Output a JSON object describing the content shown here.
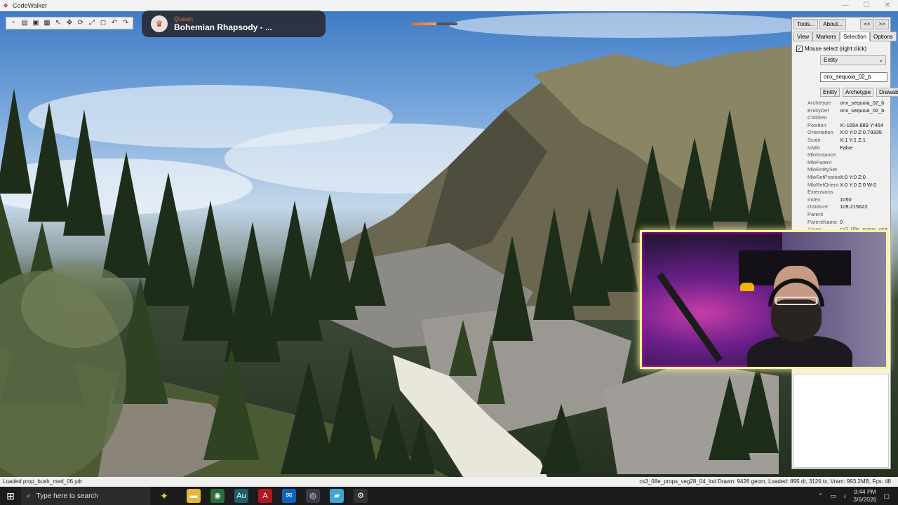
{
  "window": {
    "title": "CodeWalker",
    "controls": [
      "—",
      "☐",
      "✕"
    ]
  },
  "toolbar": {
    "buttons": [
      "new-icon",
      "open-icon",
      "save-icon",
      "save-all-icon",
      "pointer-icon",
      "move-icon",
      "rotate-icon",
      "scale-icon",
      "box-icon",
      "undo-icon",
      "redo-icon"
    ]
  },
  "now_playing": {
    "artist": "Queen",
    "song": "Bohemian Rhapsody - ...",
    "progress": 0.55
  },
  "panel": {
    "tools_label": "Tools...",
    "about_label": "About...",
    "prev_label": "<<",
    "next_label": ">>",
    "tabs": [
      "View",
      "Markers",
      "Selection",
      "Options"
    ],
    "active_tab": "Selection",
    "mouse_select_label": "Mouse select (right click)",
    "mode_value": "Entity",
    "name_value": "onx_sequoia_02_b",
    "subtabs": [
      "Entity",
      "Archetype",
      "Drawable"
    ],
    "properties": [
      {
        "key": "Archetype",
        "value": "onx_sequoia_02_b"
      },
      {
        "key": "EntityDef",
        "value": "onx_sequoia_02_b"
      },
      {
        "key": "Children",
        "value": ""
      },
      {
        "key": "Position",
        "value": "X:-1694.889 Y:454"
      },
      {
        "key": "Orientation",
        "value": "X:0 Y:0 Z:0.79335"
      },
      {
        "key": "Scale",
        "value": "X:1 Y:1 Z:1"
      },
      {
        "key": "IsMlo",
        "value": "False"
      },
      {
        "key": "MloInstance",
        "value": ""
      },
      {
        "key": "MloParent",
        "value": ""
      },
      {
        "key": "MloEntitySet",
        "value": ""
      },
      {
        "key": "MloRefPositio",
        "value": "X:0 Y:0 Z:0"
      },
      {
        "key": "MloRefOrient",
        "value": "X:0 Y:0 Z:0 W:0"
      },
      {
        "key": "Extensions",
        "value": ""
      },
      {
        "key": "Index",
        "value": "1050"
      },
      {
        "key": "Distance",
        "value": "109.215622"
      },
      {
        "key": "Parent",
        "value": ""
      },
      {
        "key": "ParentName",
        "value": "0"
      },
      {
        "key": "Ymap",
        "value": "cs3_08e_props_veg"
      }
    ]
  },
  "statusbar": {
    "left": "Loaded prop_bush_med_06.ydr",
    "right": "cs3_08e_props_veg28_04_lod  Drawn: 9426 geom, Loaded: 895 dr, 3126 tx, Vram: 993.2MB, Fps: 48"
  },
  "taskbar": {
    "search_placeholder": "Type here to search",
    "apps": [
      "file-explorer-icon",
      "chrome-icon",
      "audition-icon",
      "acrobat-icon",
      "outlook-icon",
      "obs-icon",
      "codewalker-icon",
      "settings-icon"
    ],
    "time": "9:44 PM",
    "date": "3/6/2026"
  },
  "colors": {
    "sky": "#6fa2d9",
    "panel_bg": "#f0f0f0",
    "webcam_border": "#f4f5a0",
    "taskbar_bg": "#1c1c1c",
    "progress_fill": "#e06a2a"
  }
}
